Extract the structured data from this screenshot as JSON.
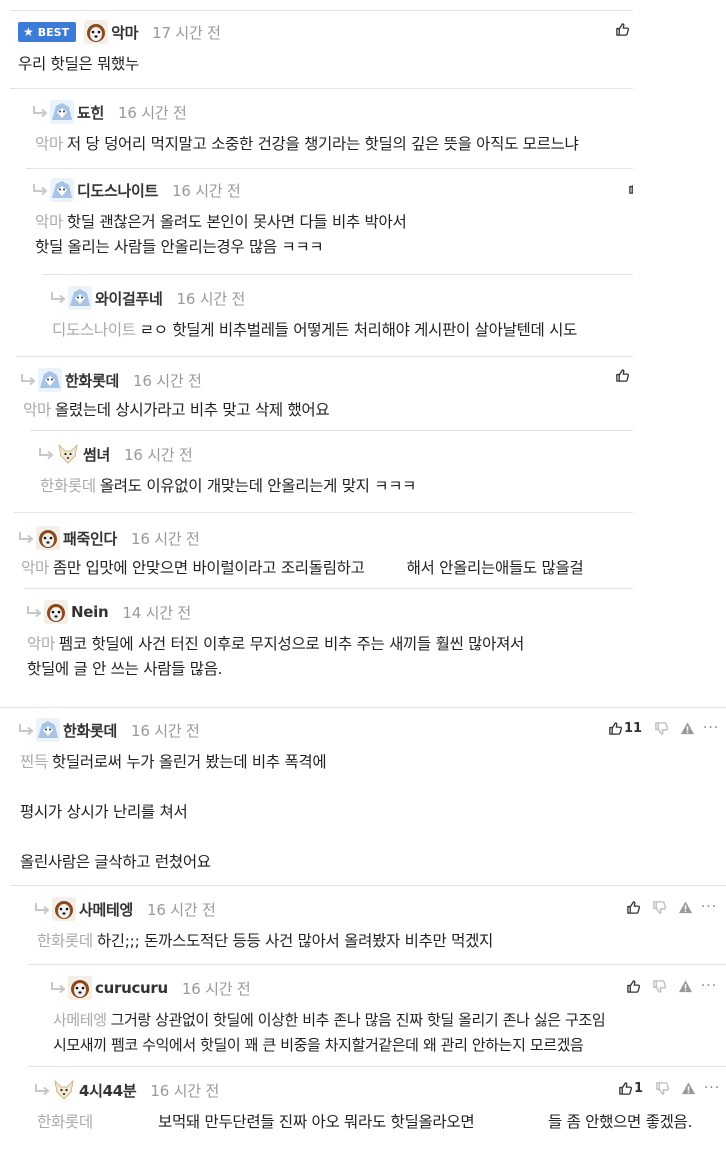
{
  "colors": {
    "best_badge": "#3c7bd8",
    "mention": "#aaaaaa",
    "time": "#999999"
  },
  "best_label": "BEST",
  "comments": [
    {
      "name": "악마",
      "time": "17 시간 전",
      "text": "우리 핫딜은 뭐했누"
    },
    {
      "name": "됴힌",
      "time": "16 시간 전",
      "mention": "악마",
      "text": "저 당 덩어리 먹지말고 소중한 건강을 챙기라는 핫딜의 깊은 뜻을 아직도 모르느냐"
    },
    {
      "name": "디도스나이트",
      "time": "16 시간 전",
      "mention": "악마",
      "text": "핫딜 괜찮은거 올려도 본인이 못사면 다들 비추 박아서",
      "text2": "핫딜 올리는 사람들 안올리는경우 많음 ㅋㅋㅋ"
    },
    {
      "name": "와이걸푸네",
      "time": "16 시간 전",
      "mention": "디도스나이트",
      "text": "ㄹㅇ 핫딜게 비추벌레들 어떻게든 처리해야 게시판이 살아날텐데 시도"
    },
    {
      "name": "한화롯데",
      "time": "16 시간 전",
      "mention": "악마",
      "text": "올렸는데 상시가라고 비추 맞고 삭제 했어요"
    },
    {
      "name": "썸녀",
      "time": "16 시간 전",
      "mention": "한화롯데",
      "text": "올려도 이유없이 개맞는데 안올리는게 맞지 ㅋㅋㅋ"
    },
    {
      "name": "패죽인다",
      "time": "16 시간 전",
      "mention": "악마",
      "text": "좀만 입맛에 안맞으면 바이럴이라고 조리돌림하고",
      "text_b": "해서 안올리는애들도 많을걸"
    },
    {
      "name": "Nein",
      "time": "14 시간 전",
      "mention": "악마",
      "text": "펨코 핫딜에 사건 터진 이후로 무지성으로 비추 주는 새끼들 훨씬 많아져서",
      "text2": "핫딜에 글 안 쓰는 사람들 많음."
    },
    {
      "name": "한화롯데",
      "time": "16 시간 전",
      "mention": "찐득",
      "text": "핫딜러로써 누가 올린거 봤는데 비추 폭격에",
      "text2": "평시가 상시가 난리를 쳐서",
      "text3": "올린사람은 글삭하고 런쳤어요",
      "likes": "11"
    },
    {
      "name": "사메테엥",
      "time": "16 시간 전",
      "mention": "한화롯데",
      "text": "하긴;;; 돈까스도적단 등등 사건 많아서 올려봤자 비추만 먹겠지"
    },
    {
      "name": "curucuru",
      "time": "16 시간 전",
      "mention": "사메테엥",
      "text": "그거랑 상관없이 핫딜에 이상한 비추 존나 많음 진짜 핫딜 올리기 존나 싫은 구조임",
      "text2": "시모새끼 펨코 수익에서 핫딜이 꽤 큰 비중을 차지할거같은데 왜 관리 안하는지 모르겠음"
    },
    {
      "name": "4시44분",
      "time": "16 시간 전",
      "mention": "한화롯데",
      "text_a": "보먹돼 만두단련들 진짜 아오 뭐라도 핫딜올라오면",
      "text_b": "들 좀 안했으면 좋겠음.",
      "likes": "1"
    }
  ],
  "more_label": "···"
}
